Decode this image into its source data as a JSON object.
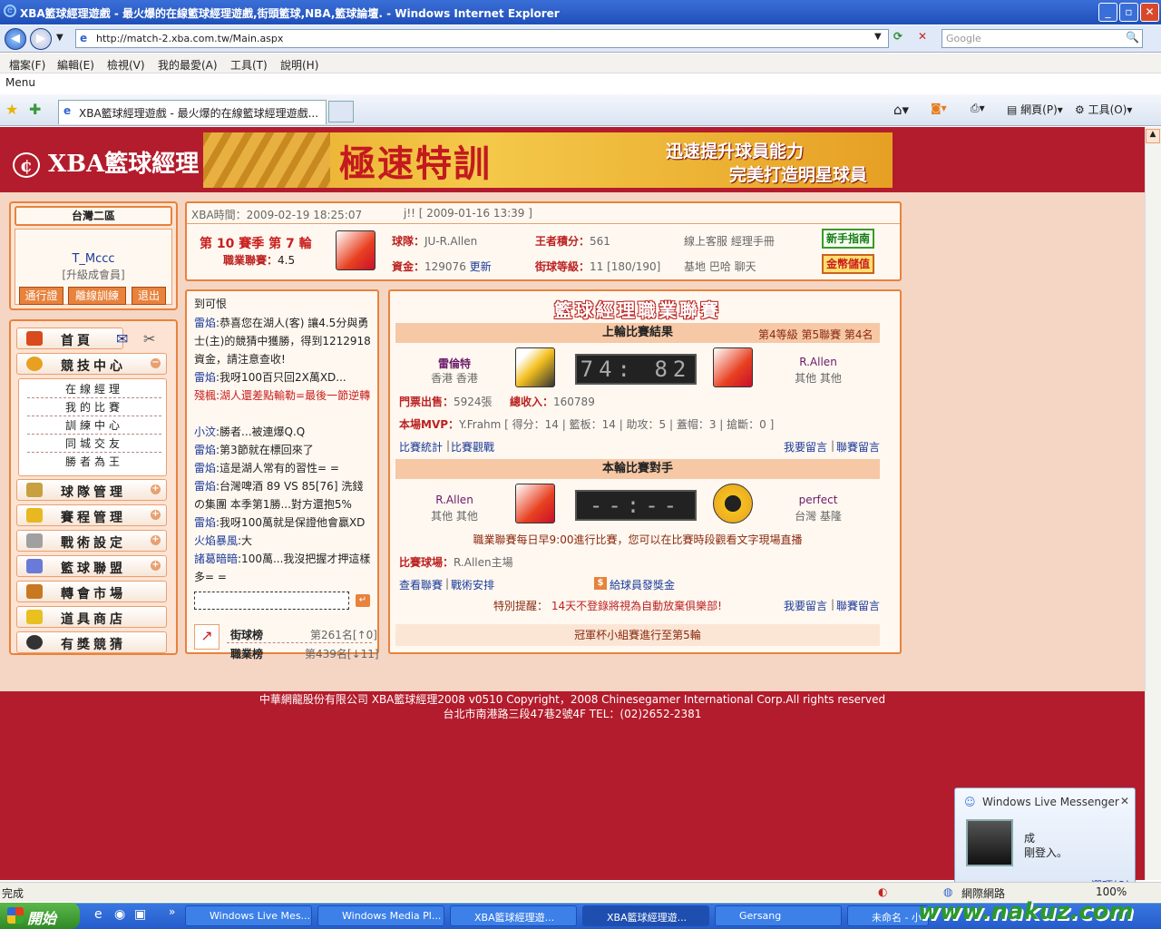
{
  "window": {
    "title": "XBA籃球經理遊戲 - 最火爆的在線籃球經理遊戲,街頭籃球,NBA,籃球論壇. - Windows Internet Explorer",
    "url": "http://match-2.xba.com.tw/Main.aspx",
    "search_placeholder": "Google",
    "menu": [
      "檔案(F)",
      "編輯(E)",
      "檢視(V)",
      "我的最愛(A)",
      "工具(T)",
      "說明(H)"
    ],
    "menu_label": "Menu",
    "tab_title": "XBA籃球經理遊戲 - 最火爆的在線籃球經理遊戲...",
    "page_btn": "網頁(P)",
    "tools_btn": "工具(O)"
  },
  "header": {
    "logo": "XBA籃球經理",
    "banner_main": "極速特訓",
    "banner_sub1": "迅速提升球員能力",
    "banner_sub2": "完美打造明星球員"
  },
  "user": {
    "region": "台灣二區",
    "name": "T_Mccc",
    "level": "[升級成會員]",
    "btn_pass": "通行證",
    "btn_offline": "離線訓練",
    "btn_logout": "退出"
  },
  "nav": {
    "home": "首頁",
    "arena": "競技中心",
    "sub": [
      "在線經理",
      "我的比賽",
      "訓練中心",
      "同城交友",
      "勝者為王"
    ],
    "team": "球隊管理",
    "schedule": "賽程管理",
    "tactics": "戰術設定",
    "league": "籃球聯盟",
    "transfer": "轉會市場",
    "shop": "道具商店",
    "prize": "有獎競猜"
  },
  "info": {
    "time": "XBA時間：2009-02-19 18:25:07",
    "notice": "j!! [ 2009-01-16 13:39 ]",
    "season": "第 10 賽季  第 7 輪",
    "league_label": "職業聯賽：",
    "league_value": "4.5",
    "team_label": "球隊：",
    "team_value": "JU-R.Allen",
    "points_label": "王者積分：",
    "points_value": "561",
    "links1": "線上客服  經理手冊",
    "btn_guide": "新手指南",
    "money_label": "資金：",
    "money_value": "129076",
    "money_update": "更新",
    "rank_label": "街球等級：",
    "rank_value": "11 [180/190]",
    "links2": "基地  巴哈  聊天",
    "btn_gold": "金幣儲值"
  },
  "chat": {
    "header": "到可恨",
    "messages": [
      {
        "who": "雷焰",
        "text": ":恭喜您在湖人(客) 讓4.5分與勇士(主)的競猜中獲勝，得到1212918資金，請注意查收!"
      },
      {
        "who": "雷焰",
        "text": ":我呀100百只回2X萬XD..."
      },
      {
        "who": "殘楓",
        "text": ":湖人還差點輸勒=最後一節逆轉"
      },
      {
        "who": "小汶",
        "text": ":勝者...被連爆Q.Q"
      },
      {
        "who": "雷焰",
        "text": ":第3節就在標回來了"
      },
      {
        "who": "雷焰",
        "text": ":這是湖人常有的習性= ="
      },
      {
        "who": "雷焰",
        "text": ":台灣啤酒  89 VS 85[76] 洗錢の集團  本季第1勝...對方還抱5%"
      },
      {
        "who": "雷焰",
        "text": ":我呀100萬就是保證他會贏XD"
      },
      {
        "who": "火焰暴風",
        "text": ":大"
      },
      {
        "who": "諸葛暗暗",
        "text": ":100萬...我沒把握才押這樣多= ="
      }
    ],
    "rank1_label": "街球榜",
    "rank1_value": "第261名[↑0]",
    "rank2_label": "職業榜",
    "rank2_value": "第439名[↓11]"
  },
  "match": {
    "title": "籃球經理職業聯賽",
    "last_head": "上輪比賽結果",
    "last_meta": "第4等級  第5聯賽  第4名",
    "home_name": "雷倫特",
    "home_loc": "香港  香港",
    "last_score": "74: 82",
    "away_name": "R.Allen",
    "away_loc": "其他  其他",
    "tickets_label": "門票出售：",
    "tickets_value": "5924張",
    "income_label": "總收入：",
    "income_value": "160789",
    "mvp_label": "本場MVP：",
    "mvp_value": "Y.Frahm [ 得分：14 | 籃板：14 | 助攻：5 | 蓋帽：3 | 搶斷：0 ]",
    "link_stats": "比賽統計",
    "link_watch": "比賽觀戰",
    "link_msg": "我要留言",
    "link_league_msg": "聯賽留言",
    "next_head": "本輪比賽對手",
    "next_home": "R.Allen",
    "next_home_loc": "其他  其他",
    "next_score": "--:--",
    "next_away": "perfect",
    "next_away_loc": "台灣  基隆",
    "notice": "職業聯賽每日早9:00進行比賽，您可以在比賽時段觀看文字現場直播",
    "venue_label": "比賽球場：",
    "venue_value": "R.Allen主場",
    "link_view_league": "查看聯賽",
    "link_tactics": "戰術安排",
    "bonus": "給球員發獎金",
    "warn_label": "特別提醒：",
    "warn_text": "14天不登錄將視為自動放棄俱樂部!",
    "cup": "冠軍杯小組賽進行至第5輪"
  },
  "footer": {
    "line1": "中華網龍股份有限公司  XBA籃球經理2008 v0510    Copyright，2008 Chinesegamer International Corp.All rights reserved",
    "line2": "台北市南港路三段47巷2號4F TEL：(02)2652-2381"
  },
  "status": {
    "text": "完成",
    "zone": "網際網路",
    "zoom": "100%"
  },
  "toast": {
    "title": "Windows Live Messenger",
    "line1": "成",
    "line2": "剛登入。",
    "options": "選項(O)"
  },
  "taskbar": {
    "start": "開始",
    "tasks": [
      "Windows Live Mes...",
      "Windows Media Pl...",
      "XBA籃球經理遊...",
      "XBA籃球經理遊...",
      "Gersang",
      "未命名 - 小"
    ],
    "watermark": "www.nakuz.com"
  }
}
